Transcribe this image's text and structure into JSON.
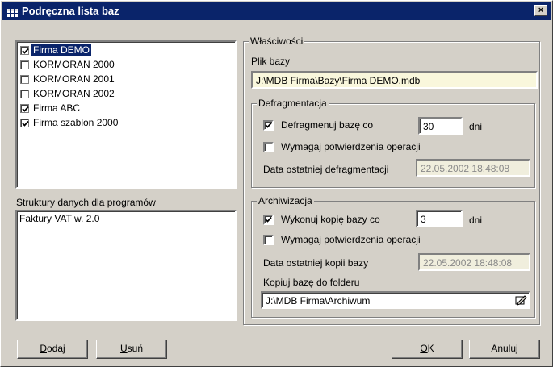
{
  "window": {
    "title": "Podręczna lista baz",
    "close_label": "×"
  },
  "databases": [
    {
      "label": "Firma DEMO",
      "checked": true,
      "selected": true
    },
    {
      "label": "KORMORAN 2000",
      "checked": false,
      "selected": false
    },
    {
      "label": "KORMORAN 2001",
      "checked": false,
      "selected": false
    },
    {
      "label": "KORMORAN 2002",
      "checked": false,
      "selected": false
    },
    {
      "label": "Firma ABC",
      "checked": true,
      "selected": false
    },
    {
      "label": "Firma szablon 2000",
      "checked": true,
      "selected": false
    }
  ],
  "structures": {
    "label": "Struktury danych dla programów",
    "items": [
      "Faktury VAT w. 2.0"
    ]
  },
  "properties": {
    "legend": "Właściwości",
    "db_file_label": "Plik bazy",
    "db_file_value": "J:\\MDB Firma\\Bazy\\Firma DEMO.mdb"
  },
  "defrag": {
    "legend": "Defragmentacja",
    "enable_label": "Defragmenuj bazę co",
    "enable_checked": true,
    "days_value": "30",
    "days_unit": "dni",
    "confirm_label": "Wymagaj potwierdzenia operacji",
    "confirm_checked": false,
    "last_label": "Data ostatniej defragmentacji",
    "last_value": "22.05.2002 18:48:08"
  },
  "archive": {
    "legend": "Archiwizacja",
    "enable_label": "Wykonuj kopię bazy co",
    "enable_checked": true,
    "days_value": "3",
    "days_unit": "dni",
    "confirm_label": "Wymagaj potwierdzenia operacji",
    "confirm_checked": false,
    "last_label": "Data ostatniej kopii bazy",
    "last_value": "22.05.2002 18:48:08",
    "folder_label": "Kopiuj bazę do folderu",
    "folder_value": "J:\\MDB Firma\\Archiwum"
  },
  "buttons": {
    "add_accel": "D",
    "add_rest": "odaj",
    "remove_accel": "U",
    "remove_rest": "suń",
    "ok_accel": "O",
    "ok_rest": "K",
    "cancel": "Anuluj"
  },
  "icons": {
    "window": "table-icon",
    "browse": "folder-edit-icon",
    "check": "checkmark-icon"
  }
}
